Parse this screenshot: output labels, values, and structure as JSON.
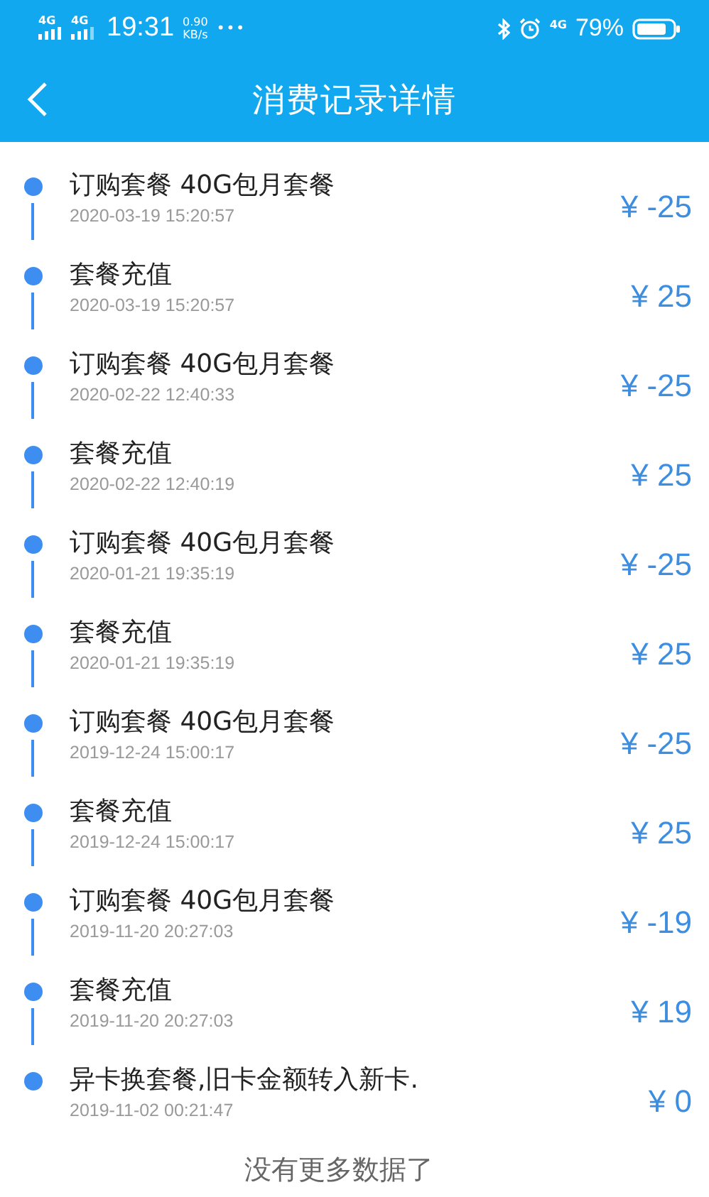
{
  "status_bar": {
    "network_labels": [
      "4G",
      "4G"
    ],
    "time": "19:31",
    "speed_value": "0.90",
    "speed_unit": "KB/s",
    "more": "•••",
    "data_label": "4G",
    "battery": "79%"
  },
  "header": {
    "title": "消费记录详情"
  },
  "records": [
    {
      "title": "订购套餐 40G包月套餐",
      "time": "2020-03-19 15:20:57",
      "amount": "¥ -25"
    },
    {
      "title": "套餐充值",
      "time": "2020-03-19 15:20:57",
      "amount": "¥ 25"
    },
    {
      "title": "订购套餐 40G包月套餐",
      "time": "2020-02-22 12:40:33",
      "amount": "¥ -25"
    },
    {
      "title": "套餐充值",
      "time": "2020-02-22 12:40:19",
      "amount": "¥ 25"
    },
    {
      "title": "订购套餐 40G包月套餐",
      "time": "2020-01-21 19:35:19",
      "amount": "¥ -25"
    },
    {
      "title": "套餐充值",
      "time": "2020-01-21 19:35:19",
      "amount": "¥ 25"
    },
    {
      "title": "订购套餐 40G包月套餐",
      "time": "2019-12-24 15:00:17",
      "amount": "¥ -25"
    },
    {
      "title": "套餐充值",
      "time": "2019-12-24 15:00:17",
      "amount": "¥ 25"
    },
    {
      "title": "订购套餐 40G包月套餐",
      "time": "2019-11-20 20:27:03",
      "amount": "¥ -19"
    },
    {
      "title": "套餐充值",
      "time": "2019-11-20 20:27:03",
      "amount": "¥ 19"
    },
    {
      "title": "异卡换套餐,旧卡金额转入新卡.",
      "time": "2019-11-02 00:21:47",
      "amount": "¥ 0"
    }
  ],
  "footer": "没有更多数据了"
}
